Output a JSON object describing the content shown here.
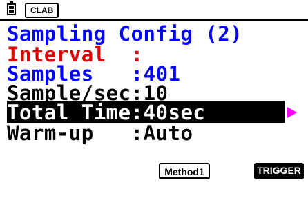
{
  "status": {
    "app_label": "CLAB",
    "battery_icon": "battery-icon"
  },
  "title": "Sampling Config (2)",
  "rows": [
    {
      "label": "Interval  ",
      "sep": ":",
      "value": "",
      "color": "#e00000"
    },
    {
      "label": "Samples   ",
      "sep": ":",
      "value": "401",
      "color": "#0000ff"
    },
    {
      "label": "Sample/sec",
      "sep": ":",
      "value": "10",
      "color": "#000000"
    },
    {
      "label": "Total Time",
      "sep": ":",
      "value": "40sec",
      "selected": true
    },
    {
      "label": "Warm-up   ",
      "sep": ":",
      "value": "Auto",
      "color": "#000000"
    }
  ],
  "function_keys": {
    "f4": "Method1",
    "f6": "TRIGGER"
  },
  "colors": {
    "title": "#0000ff",
    "interval": "#e00000",
    "selection_arrow": "#ff00ff"
  }
}
